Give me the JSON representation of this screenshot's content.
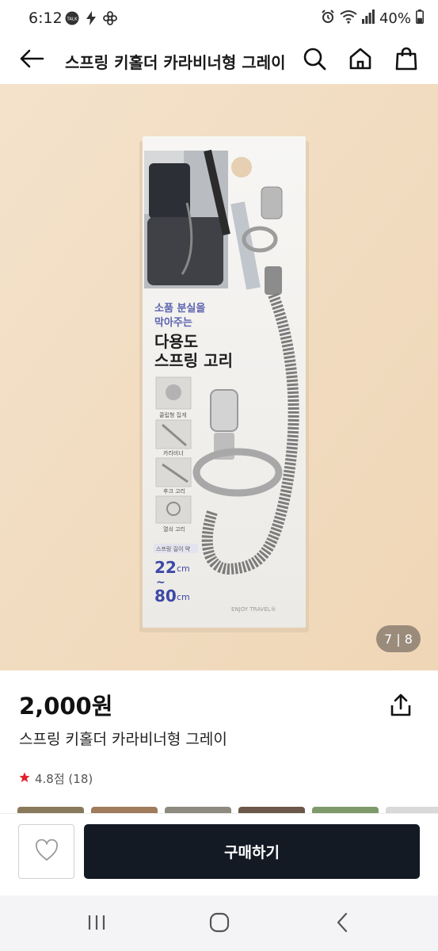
{
  "status_bar": {
    "time": "6:12",
    "left_icons": [
      "talk-icon",
      "bolt-icon",
      "pinwheel-icon"
    ],
    "right_icons": [
      "alarm-icon",
      "wifi-icon",
      "signal-icon"
    ],
    "battery_text": "40%",
    "battery_level": 0.4
  },
  "header": {
    "title": "스프링 키홀더 카라비너형 그레이"
  },
  "gallery": {
    "counter": "7 | 8",
    "current": 7,
    "total": 8,
    "package_text": {
      "line1": "소품 분실을",
      "line2": "막아주는",
      "line3": "다용도",
      "line4": "스프링 고리",
      "feature1": "클립형 집게",
      "feature2": "카라비너",
      "feature3": "후크 고리",
      "feature4": "열쇠 고리",
      "length_label": "스프링 길이 약",
      "length_min": "22",
      "length_max": "80",
      "unit": "cm",
      "tilde": "~",
      "brand": "ENJOY TRAVEL®"
    }
  },
  "product": {
    "price": "2,000원",
    "name": "스프링 키홀더 카라비너형 그레이",
    "rating_text": "4.8점 (18)",
    "star_color": "#e0212b"
  },
  "actions": {
    "buy_label": "구매하기"
  },
  "colors": {
    "buy_button": "#141a24",
    "image_background": "#f2ddc3"
  }
}
